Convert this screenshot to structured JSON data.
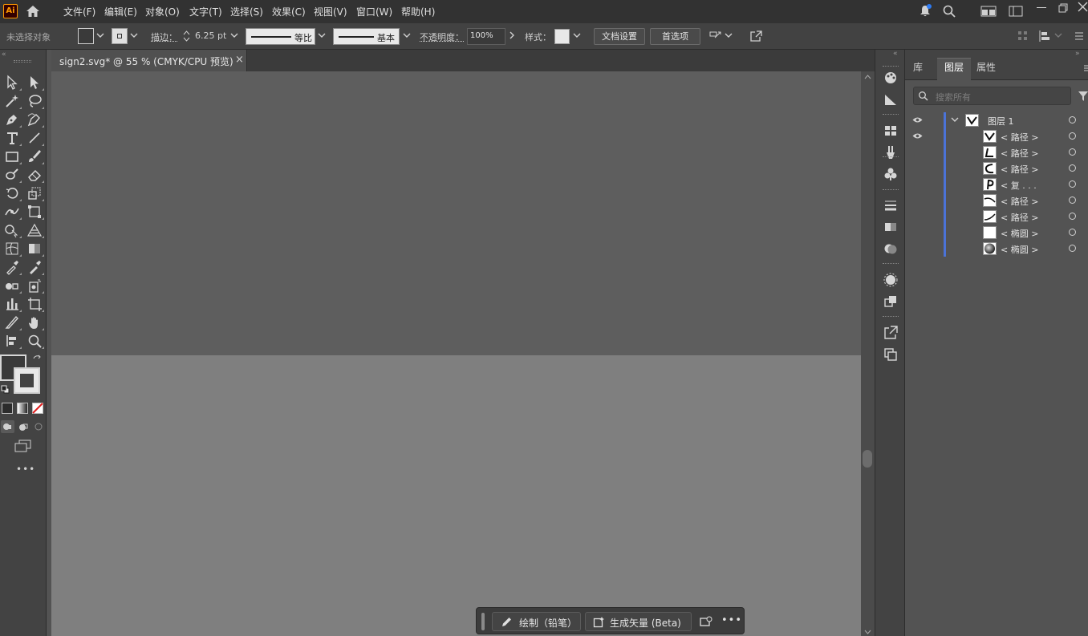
{
  "app": {
    "logo_text": "Ai"
  },
  "menu": [
    {
      "label": "文件(F)"
    },
    {
      "label": "编辑(E)"
    },
    {
      "label": "对象(O)"
    },
    {
      "label": "文字(T)"
    },
    {
      "label": "选择(S)"
    },
    {
      "label": "效果(C)"
    },
    {
      "label": "视图(V)"
    },
    {
      "label": "窗口(W)"
    },
    {
      "label": "帮助(H)"
    }
  ],
  "control_bar": {
    "no_selection": "未选择对象",
    "stroke_label": "描边：",
    "stroke_value": "6.25 pt",
    "stroke_profile": "等比",
    "brush": "基本",
    "opacity_label": "不透明度：",
    "opacity_value": "100%",
    "style_label": "样式：",
    "doc_setup": "文档设置",
    "preferences": "首选项"
  },
  "document_tab": {
    "title": "sign2.svg* @ 55 % (CMYK/CPU 预览)",
    "close": "×"
  },
  "panel": {
    "tabs": [
      "库",
      "图层",
      "属性"
    ],
    "active_tab": "图层",
    "search_placeholder": "搜索所有",
    "layer_name": "图层 1",
    "items": [
      {
        "label": "< 路径 >",
        "thumb": "check"
      },
      {
        "label": "< 路径 >",
        "thumb": "L"
      },
      {
        "label": "< 路径 >",
        "thumb": "C"
      },
      {
        "label": "< 复 . . .",
        "thumb": "P"
      },
      {
        "label": "< 路径 >",
        "thumb": "curve1"
      },
      {
        "label": "< 路径 >",
        "thumb": "curve2"
      },
      {
        "label": "< 椭圆 >",
        "thumb": "blank"
      },
      {
        "label": "< 椭圆 >",
        "thumb": "sphere"
      }
    ]
  },
  "context_bar": {
    "draw_label": "绘制（铅笔）",
    "generate_label": "生成矢量 (Beta)",
    "more": "•••"
  },
  "colors": {
    "accent": "#4b73d8",
    "menubar": "#323232",
    "artboard": "#7f7f7f",
    "pasteboard": "#5e5e5e"
  }
}
